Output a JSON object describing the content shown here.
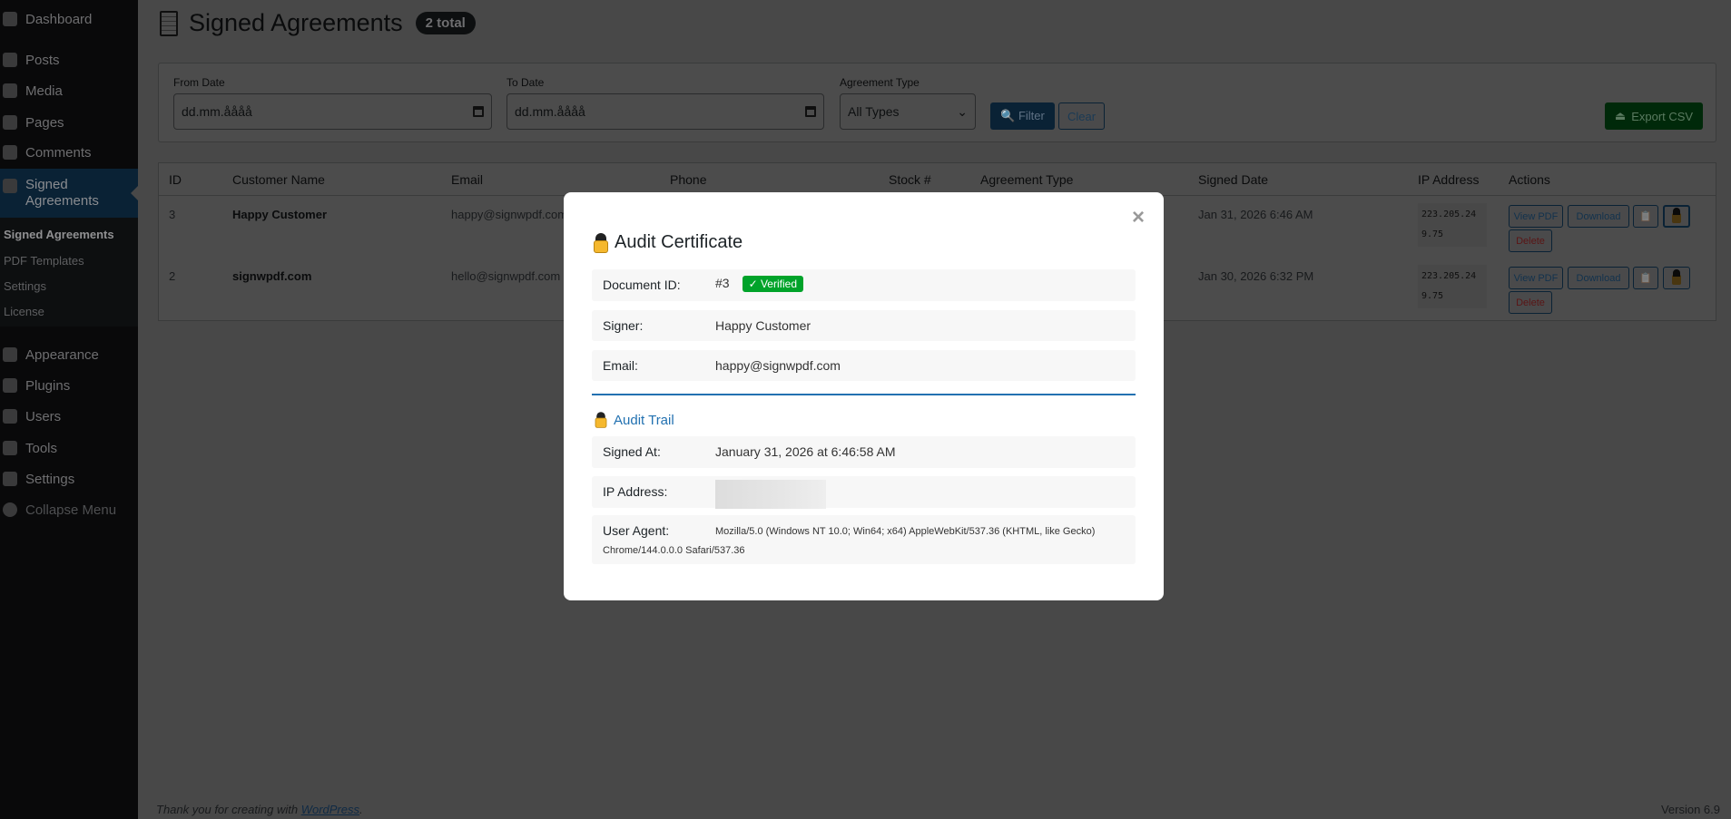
{
  "sidebar": {
    "items": [
      {
        "label": "Dashboard",
        "icon": "dashboard-icon"
      },
      {
        "label": "Posts",
        "icon": "pin-icon"
      },
      {
        "label": "Media",
        "icon": "media-icon"
      },
      {
        "label": "Pages",
        "icon": "pages-icon"
      },
      {
        "label": "Comments",
        "icon": "comments-icon"
      },
      {
        "label": "Signed Agreements",
        "icon": "document-icon"
      },
      {
        "label": "Appearance",
        "icon": "brush-icon"
      },
      {
        "label": "Plugins",
        "icon": "plug-icon"
      },
      {
        "label": "Users",
        "icon": "user-icon"
      },
      {
        "label": "Tools",
        "icon": "wrench-icon"
      },
      {
        "label": "Settings",
        "icon": "settings-icon"
      },
      {
        "label": "Collapse Menu",
        "icon": "collapse-icon"
      }
    ],
    "submenu": [
      "Signed Agreements",
      "PDF Templates",
      "Settings",
      "License"
    ]
  },
  "header": {
    "title": "Signed Agreements",
    "badge": "2 total"
  },
  "filters": {
    "from_label": "From Date",
    "from_value": "dd.mm.åååå",
    "to_label": "To Date",
    "to_value": "dd.mm.åååå",
    "type_label": "Agreement Type",
    "type_value": "All Types",
    "filter_label": "🔍 Filter",
    "clear_label": "Clear",
    "export_label": "Export CSV"
  },
  "table": {
    "headers": [
      "ID",
      "Customer Name",
      "Email",
      "Phone",
      "Stock #",
      "Agreement Type",
      "Signed Date",
      "IP Address",
      "Actions"
    ],
    "rows": [
      {
        "id": "3",
        "name": "Happy Customer",
        "email": "happy@signwpdf.com",
        "date": "Jan 31, 2026 6:46 AM",
        "ip": "223.205.249.75"
      },
      {
        "id": "2",
        "name": "signwpdf.com",
        "email": "hello@signwpdf.com",
        "date": "Jan 30, 2026 6:32 PM",
        "ip": "223.205.249.75"
      }
    ],
    "actions": {
      "view": "View PDF",
      "download": "Download",
      "delete": "Delete"
    }
  },
  "footer": {
    "thanks": "Thank you for creating with ",
    "link": "WordPress",
    "period": ".",
    "version": "Version 6.9"
  },
  "modal": {
    "close": "×",
    "title": "Audit Certificate",
    "doc_label": "Document ID:",
    "doc_value": "#3",
    "verified": "✓ Verified",
    "signer_label": "Signer:",
    "signer_value": "Happy Customer",
    "email_label": "Email:",
    "email_value": "happy@signwpdf.com",
    "trail_title": "Audit Trail",
    "signed_label": "Signed At:",
    "signed_value": "January 31, 2026 at 6:46:58 AM",
    "ip_label": "IP Address:",
    "ua_label": "User Agent:",
    "ua_value1": "Mozilla/5.0 (Windows NT 10.0; Win64; x64) AppleWebKit/537.36 (KHTML, like Gecko)",
    "ua_value2": "Chrome/144.0.0.0 Safari/537.36"
  },
  "colors": {
    "accent": "#2271b1",
    "verified": "#00a32a",
    "export": "#008a20"
  }
}
